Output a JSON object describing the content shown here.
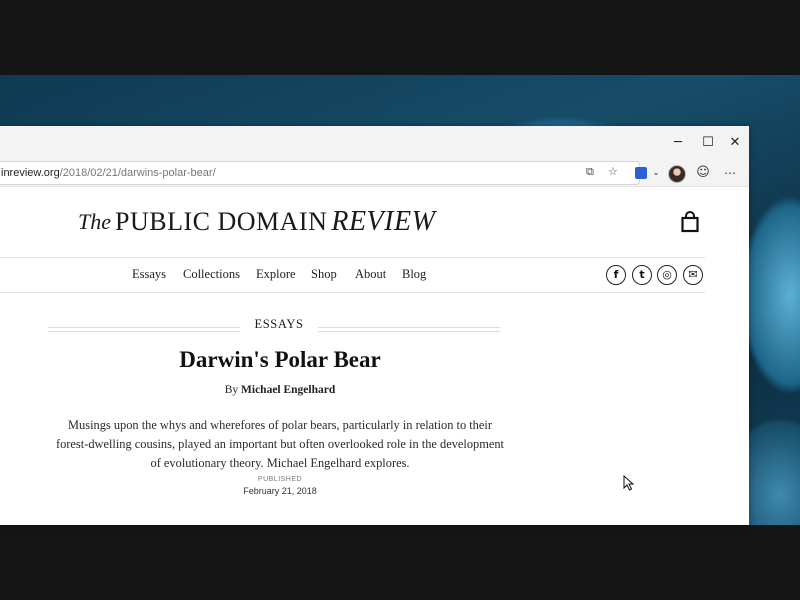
{
  "browser": {
    "url_domain": "inreview.org",
    "url_path": "/2018/02/21/darwins-polar-bear/",
    "window_controls": {
      "minimize": "─",
      "maximize": "☐",
      "close": "✕"
    },
    "toolbar_icons": [
      "reader-view-icon",
      "favorites-star-icon",
      "extension-icon",
      "chevron-down-icon",
      "profile-avatar",
      "emoji-feedback-icon",
      "more-menu-icon"
    ]
  },
  "site": {
    "logo_the": "The",
    "logo_main": "PUBLIC DOMAIN",
    "logo_review": "REVIEW",
    "nav": [
      "Essays",
      "Collections",
      "Explore",
      "Shop",
      "About",
      "Blog"
    ],
    "social_icons": [
      "facebook-icon",
      "twitter-icon",
      "instagram-icon",
      "email-icon"
    ],
    "social_glyphs": [
      "f",
      "t",
      "◎",
      "✉"
    ]
  },
  "article": {
    "section": "ESSAYS",
    "title": "Darwin's Polar Bear",
    "byline_prefix": "By",
    "author": "Michael Engelhard",
    "standfirst_lines": [
      "Musings upon the whys and wherefores of polar bears, particularly in relation to their",
      "forest-dwelling cousins, played an important but often overlooked role in the development",
      "of evolutionary theory. Michael Engelhard explores."
    ],
    "published_label": "PUBLISHED",
    "published_date": "February 21, 2018"
  }
}
